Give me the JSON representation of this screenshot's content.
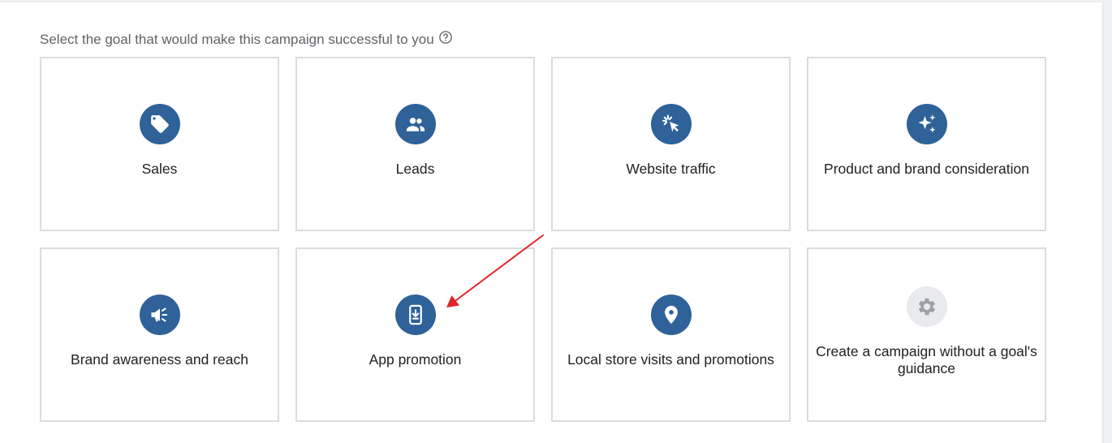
{
  "prompt": {
    "text": "Select the goal that would make this campaign successful to you",
    "help_icon": "help-circle-icon"
  },
  "colors": {
    "icon_bg": "#2e6299",
    "icon_bg_disabled": "#e8eaed",
    "card_border": "#dadce0",
    "annotation_arrow": "#e0242b"
  },
  "goals": [
    {
      "label": "Sales",
      "icon": "sales-tag-icon"
    },
    {
      "label": "Leads",
      "icon": "leads-people-icon"
    },
    {
      "label": "Website traffic",
      "icon": "website-traffic-cursor-icon"
    },
    {
      "label": "Product and brand consideration",
      "icon": "sparkle-icon"
    },
    {
      "label": "Brand awareness and reach",
      "icon": "megaphone-icon"
    },
    {
      "label": "App promotion",
      "icon": "phone-download-icon"
    },
    {
      "label": "Local store visits and promotions",
      "icon": "location-pin-icon"
    },
    {
      "label": "Create a campaign without a goal's guidance",
      "icon": "gear-icon"
    }
  ]
}
